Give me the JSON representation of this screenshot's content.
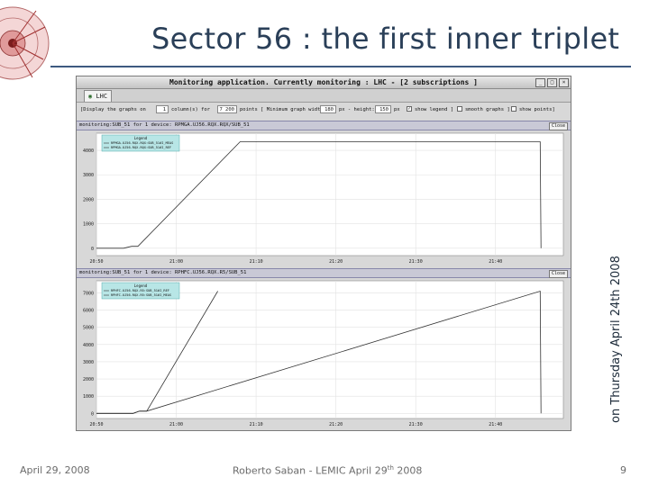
{
  "slide": {
    "title": "Sector 56 : the first inner triplet",
    "side_note": "on Thursday April 24th 2008",
    "footer_date": "April 29, 2008",
    "footer_author": "Roberto Saban - LEMIC April 29",
    "footer_author_sup": "th",
    "footer_author_tail": " 2008",
    "page_number": "9",
    "accent_color": "#2a3f58"
  },
  "app": {
    "window_title": "Monitoring application. Currently monitoring : LHC - [2 subscriptions ]",
    "tab_label": "LHC",
    "toolbar": {
      "display_label": "[Display the graphs on",
      "columns_value": "1",
      "columns_label": "column(s) for",
      "points_value": "7 200",
      "points_label": "points [ Minimum graph width:",
      "width_value": "180",
      "px_height_label": "px - height:",
      "height_value": "150",
      "px_label": "px",
      "show_legend_label": "show legend ]",
      "show_legend_checked": true,
      "smooth_label": "smooth graphs ]",
      "smooth_checked": false,
      "show_points_label": "show points]",
      "show_points_checked": false
    },
    "close_label": "Close",
    "panels": [
      {
        "header": "monitoring:SUB_51 for 1 device: RPMGA.UJ56.RQX.RQX/SUB_51",
        "legend_title": "Legend",
        "legend_items": [
          "RPMGA.UJ56.RQX.RQX:SUB_51#I_MEAS",
          "RPMGA.UJ56.RQX.RQX:SUB_51#I_REF"
        ]
      },
      {
        "header": "monitoring:SUB_51 for 1 device: RPHFC.UJ56.RQX.R5/SUB_51",
        "legend_title": "Legend",
        "legend_items": [
          "RPHFC.UJ56.RQX.R5:SUB_51#I_REF",
          "RPHFC.UJ56.RQX.R5:SUB_51#I_MEAS"
        ]
      }
    ]
  },
  "chart_data": [
    {
      "type": "line",
      "title": "",
      "x_ticks": [
        "20:50",
        "21:00",
        "21:10",
        "21:20",
        "21:30",
        "21:40"
      ],
      "y_ticks": [
        0,
        1000,
        2000,
        3000,
        4000
      ],
      "ylim": [
        -300,
        4700
      ],
      "xlim_minutes": [
        0,
        58.5
      ],
      "series": [
        {
          "name": "RPMGA.UJ56.RQX.RQX:SUB_51#I_MEAS",
          "color": "#333333",
          "x": [
            0,
            3.4,
            4.4,
            5.2,
            18.0,
            19.2,
            55.6,
            55.7
          ],
          "y": [
            0,
            0,
            80,
            80,
            4350,
            4350,
            4350,
            0
          ]
        }
      ],
      "grid": true,
      "legend_position": "top-left"
    },
    {
      "type": "line",
      "title": "",
      "x_ticks": [
        "20:50",
        "21:00",
        "21:10",
        "21:20",
        "21:30",
        "21:40"
      ],
      "y_ticks": [
        0,
        1000,
        2000,
        3000,
        4000,
        5000,
        6000,
        7000
      ],
      "ylim": [
        -300,
        7700
      ],
      "xlim_minutes": [
        0,
        58.5
      ],
      "series": [
        {
          "name": "RPHFC.UJ56.RQX.R5:SUB_51#I_REF",
          "color": "#333333",
          "x": [
            0,
            4.6,
            5.4,
            6.3,
            15.2
          ],
          "y": [
            0,
            0,
            130,
            130,
            7100
          ]
        },
        {
          "name": "RPHFC.UJ56.RQX.R5:SUB_51#I_MEAS",
          "color": "#333333",
          "x": [
            0,
            4.6,
            5.4,
            6.3,
            55.6,
            55.7
          ],
          "y": [
            0,
            0,
            130,
            130,
            7100,
            0
          ]
        }
      ],
      "grid": true,
      "legend_position": "top-left"
    }
  ]
}
